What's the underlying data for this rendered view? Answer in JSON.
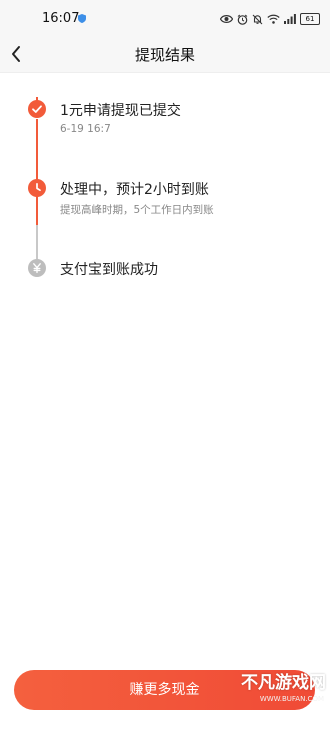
{
  "status_bar": {
    "time": "16:07",
    "battery": "61"
  },
  "nav": {
    "title": "提现结果"
  },
  "steps": [
    {
      "title": "1元申请提现已提交",
      "subtitle": "6-19 16:7",
      "state": "done",
      "icon": "check-icon"
    },
    {
      "title": "处理中，预计2小时到账",
      "subtitle": "提现高峰时期，5个工作日内到账",
      "state": "in-progress",
      "icon": "clock-icon"
    },
    {
      "title": "支付宝到账成功",
      "subtitle": "",
      "state": "pending",
      "icon": "yen-icon"
    }
  ],
  "cta": {
    "label": "赚更多现金"
  },
  "watermark": {
    "main": "不凡游戏网",
    "sub": "WWW.BUFAN.COM"
  },
  "colors": {
    "accent": "#f25b3a",
    "pending": "#c8c8c8",
    "background": "#ffffff",
    "bar": "#f7f7f7"
  }
}
